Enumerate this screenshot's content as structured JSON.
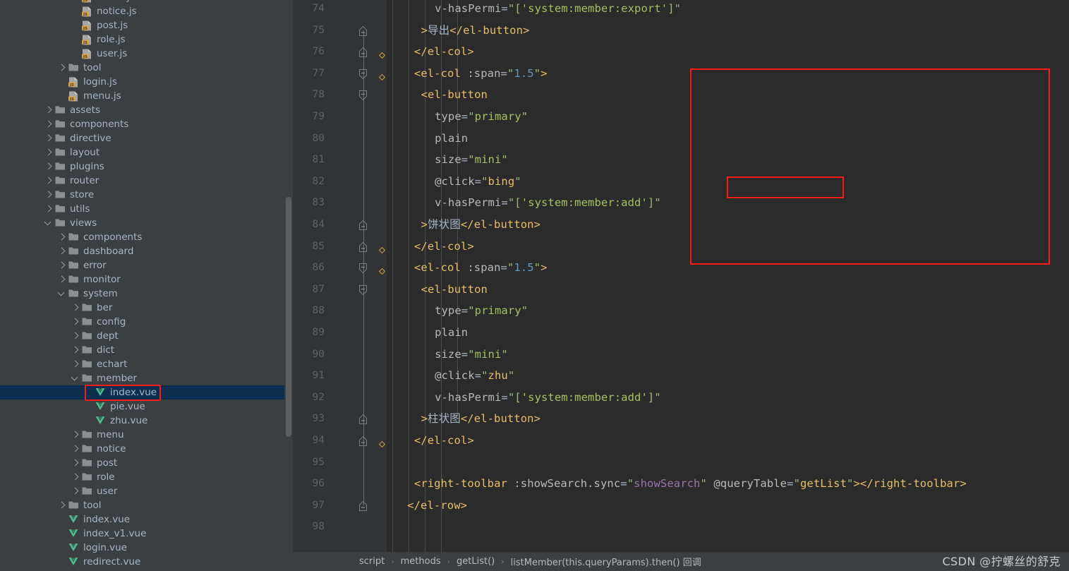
{
  "project_tree": {
    "scrollbar": {
      "visible": true
    },
    "items": [
      {
        "depth": 3,
        "kind": "js",
        "label": "menu.js",
        "arrow": "none",
        "selected": false
      },
      {
        "depth": 3,
        "kind": "js",
        "label": "notice.js",
        "arrow": "none",
        "selected": false
      },
      {
        "depth": 3,
        "kind": "js",
        "label": "post.js",
        "arrow": "none",
        "selected": false
      },
      {
        "depth": 3,
        "kind": "js",
        "label": "role.js",
        "arrow": "none",
        "selected": false
      },
      {
        "depth": 3,
        "kind": "js",
        "label": "user.js",
        "arrow": "none",
        "selected": false
      },
      {
        "depth": 2,
        "kind": "folder",
        "label": "tool",
        "arrow": "collapsed",
        "selected": false
      },
      {
        "depth": 2,
        "kind": "js",
        "label": "login.js",
        "arrow": "none",
        "selected": false
      },
      {
        "depth": 2,
        "kind": "js",
        "label": "menu.js",
        "arrow": "none",
        "selected": false
      },
      {
        "depth": 1,
        "kind": "folder",
        "label": "assets",
        "arrow": "collapsed",
        "selected": false
      },
      {
        "depth": 1,
        "kind": "folder",
        "label": "components",
        "arrow": "collapsed",
        "selected": false
      },
      {
        "depth": 1,
        "kind": "folder",
        "label": "directive",
        "arrow": "collapsed",
        "selected": false
      },
      {
        "depth": 1,
        "kind": "folder",
        "label": "layout",
        "arrow": "collapsed",
        "selected": false
      },
      {
        "depth": 1,
        "kind": "folder",
        "label": "plugins",
        "arrow": "collapsed",
        "selected": false
      },
      {
        "depth": 1,
        "kind": "folder",
        "label": "router",
        "arrow": "collapsed",
        "selected": false
      },
      {
        "depth": 1,
        "kind": "folder",
        "label": "store",
        "arrow": "collapsed",
        "selected": false
      },
      {
        "depth": 1,
        "kind": "folder",
        "label": "utils",
        "arrow": "collapsed",
        "selected": false
      },
      {
        "depth": 1,
        "kind": "folder",
        "label": "views",
        "arrow": "expanded",
        "selected": false
      },
      {
        "depth": 2,
        "kind": "folder",
        "label": "components",
        "arrow": "collapsed",
        "selected": false
      },
      {
        "depth": 2,
        "kind": "folder",
        "label": "dashboard",
        "arrow": "collapsed",
        "selected": false
      },
      {
        "depth": 2,
        "kind": "folder",
        "label": "error",
        "arrow": "collapsed",
        "selected": false
      },
      {
        "depth": 2,
        "kind": "folder",
        "label": "monitor",
        "arrow": "collapsed",
        "selected": false
      },
      {
        "depth": 2,
        "kind": "folder",
        "label": "system",
        "arrow": "expanded",
        "selected": false
      },
      {
        "depth": 3,
        "kind": "folder",
        "label": "ber",
        "arrow": "collapsed",
        "selected": false
      },
      {
        "depth": 3,
        "kind": "folder",
        "label": "config",
        "arrow": "collapsed",
        "selected": false
      },
      {
        "depth": 3,
        "kind": "folder",
        "label": "dept",
        "arrow": "collapsed",
        "selected": false
      },
      {
        "depth": 3,
        "kind": "folder",
        "label": "dict",
        "arrow": "collapsed",
        "selected": false
      },
      {
        "depth": 3,
        "kind": "folder",
        "label": "echart",
        "arrow": "collapsed",
        "selected": false
      },
      {
        "depth": 3,
        "kind": "folder",
        "label": "member",
        "arrow": "expanded",
        "selected": false
      },
      {
        "depth": 4,
        "kind": "vue",
        "label": "index.vue",
        "arrow": "none",
        "selected": true
      },
      {
        "depth": 4,
        "kind": "vue",
        "label": "pie.vue",
        "arrow": "none",
        "selected": false
      },
      {
        "depth": 4,
        "kind": "vue",
        "label": "zhu.vue",
        "arrow": "none",
        "selected": false
      },
      {
        "depth": 3,
        "kind": "folder",
        "label": "menu",
        "arrow": "collapsed",
        "selected": false
      },
      {
        "depth": 3,
        "kind": "folder",
        "label": "notice",
        "arrow": "collapsed",
        "selected": false
      },
      {
        "depth": 3,
        "kind": "folder",
        "label": "post",
        "arrow": "collapsed",
        "selected": false
      },
      {
        "depth": 3,
        "kind": "folder",
        "label": "role",
        "arrow": "collapsed",
        "selected": false
      },
      {
        "depth": 3,
        "kind": "folder",
        "label": "user",
        "arrow": "collapsed",
        "selected": false
      },
      {
        "depth": 2,
        "kind": "folder",
        "label": "tool",
        "arrow": "collapsed",
        "selected": false
      },
      {
        "depth": 2,
        "kind": "vue",
        "label": "index.vue",
        "arrow": "none",
        "selected": false
      },
      {
        "depth": 2,
        "kind": "vue",
        "label": "index_v1.vue",
        "arrow": "none",
        "selected": false
      },
      {
        "depth": 2,
        "kind": "vue",
        "label": "login.vue",
        "arrow": "none",
        "selected": false
      },
      {
        "depth": 2,
        "kind": "vue",
        "label": "redirect.vue",
        "arrow": "none",
        "selected": false
      }
    ]
  },
  "editor": {
    "first_line_number": 74,
    "lines": [
      {
        "n": 74,
        "indent": 7,
        "tokens": [
          {
            "t": "attr",
            "v": "v-hasPermi"
          },
          {
            "t": "eq",
            "v": "="
          },
          {
            "t": "strq",
            "v": "\"["
          },
          {
            "t": "str",
            "v": "'system:member:export'"
          },
          {
            "t": "strq",
            "v": "]\""
          }
        ]
      },
      {
        "n": 75,
        "indent": 5,
        "tokens": [
          {
            "t": "tag",
            "v": ">"
          },
          {
            "t": "text",
            "v": "导出"
          },
          {
            "t": "tag",
            "v": "</el-button>"
          }
        ]
      },
      {
        "n": 76,
        "indent": 4,
        "tokens": [
          {
            "t": "tag",
            "v": "</el-col>"
          }
        ]
      },
      {
        "n": 77,
        "indent": 4,
        "tokens": [
          {
            "t": "tag",
            "v": "<el-col "
          },
          {
            "t": "attr",
            "v": ":span"
          },
          {
            "t": "eq",
            "v": "="
          },
          {
            "t": "strq",
            "v": "\""
          },
          {
            "t": "num",
            "v": "1.5"
          },
          {
            "t": "strq",
            "v": "\""
          },
          {
            "t": "tag",
            "v": ">"
          }
        ]
      },
      {
        "n": 78,
        "indent": 5,
        "tokens": [
          {
            "t": "tag",
            "v": "<el-button"
          }
        ]
      },
      {
        "n": 79,
        "indent": 7,
        "tokens": [
          {
            "t": "attr",
            "v": "type"
          },
          {
            "t": "eq",
            "v": "="
          },
          {
            "t": "strq",
            "v": "\""
          },
          {
            "t": "str",
            "v": "primary"
          },
          {
            "t": "strq",
            "v": "\""
          }
        ]
      },
      {
        "n": 80,
        "indent": 7,
        "tokens": [
          {
            "t": "attr",
            "v": "plain"
          }
        ]
      },
      {
        "n": 81,
        "indent": 7,
        "tokens": [
          {
            "t": "attr",
            "v": "size"
          },
          {
            "t": "eq",
            "v": "="
          },
          {
            "t": "strq",
            "v": "\""
          },
          {
            "t": "str",
            "v": "mini"
          },
          {
            "t": "strq",
            "v": "\""
          }
        ]
      },
      {
        "n": 82,
        "indent": 7,
        "tokens": [
          {
            "t": "attr",
            "v": "@click"
          },
          {
            "t": "eq",
            "v": "="
          },
          {
            "t": "strq",
            "v": "\""
          },
          {
            "t": "tag",
            "v": "bing"
          },
          {
            "t": "strq",
            "v": "\""
          }
        ]
      },
      {
        "n": 83,
        "indent": 7,
        "tokens": [
          {
            "t": "attr",
            "v": "v-hasPermi"
          },
          {
            "t": "eq",
            "v": "="
          },
          {
            "t": "strq",
            "v": "\"["
          },
          {
            "t": "str",
            "v": "'system:member:add'"
          },
          {
            "t": "strq",
            "v": "]\""
          }
        ]
      },
      {
        "n": 84,
        "indent": 5,
        "tokens": [
          {
            "t": "tag",
            "v": ">"
          },
          {
            "t": "text",
            "v": "饼状图"
          },
          {
            "t": "tag",
            "v": "</el-button>"
          }
        ]
      },
      {
        "n": 85,
        "indent": 4,
        "tokens": [
          {
            "t": "tag",
            "v": "</el-col>"
          }
        ]
      },
      {
        "n": 86,
        "indent": 4,
        "tokens": [
          {
            "t": "tag",
            "v": "<el-col "
          },
          {
            "t": "attr",
            "v": ":span"
          },
          {
            "t": "eq",
            "v": "="
          },
          {
            "t": "strq",
            "v": "\""
          },
          {
            "t": "num",
            "v": "1.5"
          },
          {
            "t": "strq",
            "v": "\""
          },
          {
            "t": "tag",
            "v": ">"
          }
        ]
      },
      {
        "n": 87,
        "indent": 5,
        "tokens": [
          {
            "t": "tag",
            "v": "<el-button"
          }
        ]
      },
      {
        "n": 88,
        "indent": 7,
        "tokens": [
          {
            "t": "attr",
            "v": "type"
          },
          {
            "t": "eq",
            "v": "="
          },
          {
            "t": "strq",
            "v": "\""
          },
          {
            "t": "str",
            "v": "primary"
          },
          {
            "t": "strq",
            "v": "\""
          }
        ]
      },
      {
        "n": 89,
        "indent": 7,
        "tokens": [
          {
            "t": "attr",
            "v": "plain"
          }
        ]
      },
      {
        "n": 90,
        "indent": 7,
        "tokens": [
          {
            "t": "attr",
            "v": "size"
          },
          {
            "t": "eq",
            "v": "="
          },
          {
            "t": "strq",
            "v": "\""
          },
          {
            "t": "str",
            "v": "mini"
          },
          {
            "t": "strq",
            "v": "\""
          }
        ]
      },
      {
        "n": 91,
        "indent": 7,
        "tokens": [
          {
            "t": "attr",
            "v": "@click"
          },
          {
            "t": "eq",
            "v": "="
          },
          {
            "t": "strq",
            "v": "\""
          },
          {
            "t": "tag",
            "v": "zhu"
          },
          {
            "t": "strq",
            "v": "\""
          }
        ]
      },
      {
        "n": 92,
        "indent": 7,
        "tokens": [
          {
            "t": "attr",
            "v": "v-hasPermi"
          },
          {
            "t": "eq",
            "v": "="
          },
          {
            "t": "strq",
            "v": "\"["
          },
          {
            "t": "str",
            "v": "'system:member:add'"
          },
          {
            "t": "strq",
            "v": "]\""
          }
        ]
      },
      {
        "n": 93,
        "indent": 5,
        "tokens": [
          {
            "t": "tag",
            "v": ">"
          },
          {
            "t": "text",
            "v": "柱状图"
          },
          {
            "t": "tag",
            "v": "</el-button>"
          }
        ]
      },
      {
        "n": 94,
        "indent": 4,
        "tokens": [
          {
            "t": "tag",
            "v": "</el-col>"
          }
        ]
      },
      {
        "n": 95,
        "indent": 0,
        "tokens": []
      },
      {
        "n": 96,
        "indent": 4,
        "tokens": [
          {
            "t": "tag",
            "v": "<right-toolbar "
          },
          {
            "t": "attr",
            "v": ":showSearch.sync"
          },
          {
            "t": "eq",
            "v": "="
          },
          {
            "t": "strq",
            "v": "\""
          },
          {
            "t": "sync",
            "v": "showSearch"
          },
          {
            "t": "strq",
            "v": "\""
          },
          {
            "t": "attr",
            "v": " @queryTable"
          },
          {
            "t": "eq",
            "v": "="
          },
          {
            "t": "strq",
            "v": "\""
          },
          {
            "t": "tag",
            "v": "getList"
          },
          {
            "t": "strq",
            "v": "\""
          },
          {
            "t": "tag",
            "v": "></right-toolbar>"
          }
        ]
      },
      {
        "n": 97,
        "indent": 3,
        "tokens": [
          {
            "t": "tag",
            "v": "</el-row>"
          }
        ]
      },
      {
        "n": 98,
        "indent": 0,
        "tokens": []
      }
    ],
    "fold_markers": [
      {
        "line": 75,
        "type": "end"
      },
      {
        "line": 76,
        "type": "end"
      },
      {
        "line": 77,
        "type": "start"
      },
      {
        "line": 78,
        "type": "start"
      },
      {
        "line": 84,
        "type": "end"
      },
      {
        "line": 85,
        "type": "end"
      },
      {
        "line": 86,
        "type": "start"
      },
      {
        "line": 87,
        "type": "start"
      },
      {
        "line": 93,
        "type": "end"
      },
      {
        "line": 94,
        "type": "end"
      },
      {
        "line": 97,
        "type": "end"
      }
    ]
  },
  "annotations": {
    "code_block_box_label": "highlighted-pie-chart-button-block",
    "click_attr_box_label": "highlighted-click-bing-attribute",
    "index_vue_box_label": "highlighted-index-vue-file"
  },
  "status_bar": {
    "breadcrumb": [
      "script",
      "methods",
      "getList()",
      "listMember(this.queryParams).then() 回调"
    ],
    "separator": "›"
  },
  "watermark": {
    "text": "CSDN @拧螺丝的舒克"
  },
  "colors": {
    "tree_bg": "#3c3f41",
    "editor_bg": "#2b2b2b",
    "gutter_bg": "#313335",
    "selection_bg": "#0d2f4f",
    "annotation_red": "#ff1a1a",
    "tag": "#e8bf6a",
    "attr": "#bababa",
    "string": "#a5c261",
    "number": "#6897bb",
    "text": "#a9b7c6",
    "vue_green": "#4fc08d",
    "js_yellow": "#d9a343",
    "line_number": "#606366"
  }
}
